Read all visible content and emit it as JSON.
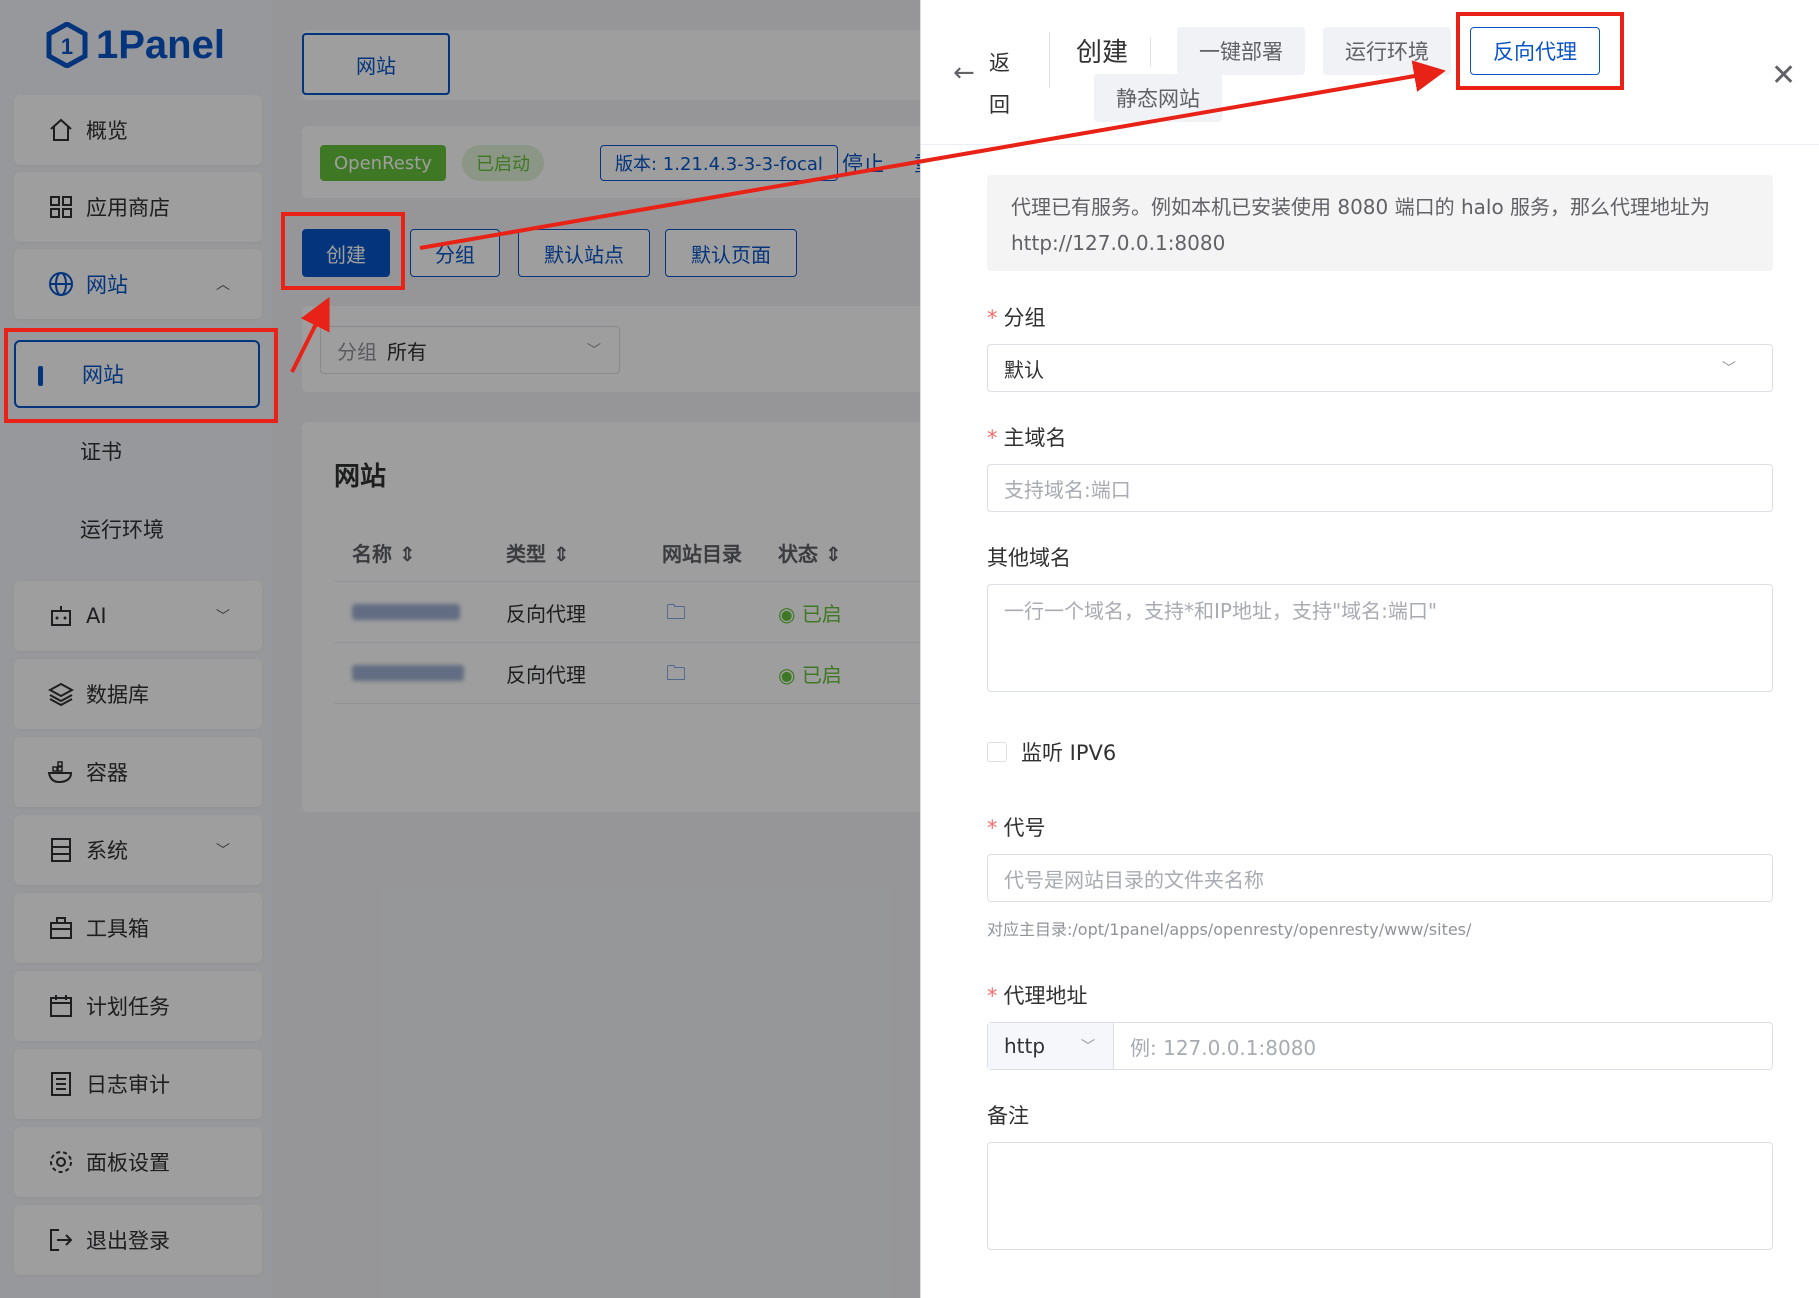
{
  "sidebar": {
    "logo": "1Panel",
    "items": [
      {
        "label": "概览",
        "icon": "home-icon"
      },
      {
        "label": "应用商店",
        "icon": "grid-icon"
      },
      {
        "label": "网站",
        "icon": "globe-icon"
      },
      {
        "label": "AI",
        "icon": "robot-icon"
      },
      {
        "label": "数据库",
        "icon": "layers-icon"
      },
      {
        "label": "容器",
        "icon": "docker-icon"
      },
      {
        "label": "系统",
        "icon": "server-icon"
      },
      {
        "label": "工具箱",
        "icon": "toolbox-icon"
      },
      {
        "label": "计划任务",
        "icon": "calendar-icon"
      },
      {
        "label": "日志审计",
        "icon": "log-icon"
      },
      {
        "label": "面板设置",
        "icon": "gear-icon"
      },
      {
        "label": "退出登录",
        "icon": "logout-icon"
      }
    ],
    "sub": {
      "selected": "网站",
      "cert": "证书",
      "runtime": "运行环境"
    }
  },
  "main": {
    "top_tab": "网站",
    "openresty": "OpenResty",
    "status": "已启动",
    "version": "版本: 1.21.4.3-3-3-focal",
    "stop": "停止",
    "restart": "重",
    "toolbar": {
      "create": "创建",
      "group": "分组",
      "default_site": "默认站点",
      "default_page": "默认页面"
    },
    "filter": {
      "label": "分组",
      "value": "所有"
    },
    "card_title": "网站",
    "columns": [
      "名称",
      "类型",
      "网站目录",
      "状态"
    ],
    "rows": [
      {
        "type": "反向代理",
        "status": "已启"
      },
      {
        "type": "反向代理",
        "status": "已启"
      }
    ]
  },
  "drawer": {
    "back": "返回",
    "title": "创建",
    "tabs": [
      "一键部署",
      "运行环境",
      "反向代理",
      "静态网站"
    ],
    "info": "代理已有服务。例如本机已安装使用 8080 端口的 halo 服务，那么代理地址为 http://127.0.0.1:8080",
    "group_label": "分组",
    "group_value": "默认",
    "domain_label": "主域名",
    "domain_placeholder": "支持域名:端口",
    "other_label": "其他域名",
    "other_placeholder": "一行一个域名，支持*和IP地址，支持\"域名:端口\"",
    "ipv6_label": "监听 IPV6",
    "alias_label": "代号",
    "alias_placeholder": "代号是网站目录的文件夹名称",
    "alias_hint": "对应主目录:/opt/1panel/apps/openresty/openresty/www/sites/",
    "proxy_label": "代理地址",
    "proxy_scheme": "http",
    "proxy_placeholder": "例: 127.0.0.1:8080",
    "remark_label": "备注"
  },
  "colors": {
    "primary": "#0854c7",
    "annotation": "#e82216",
    "success": "#67c23a"
  }
}
